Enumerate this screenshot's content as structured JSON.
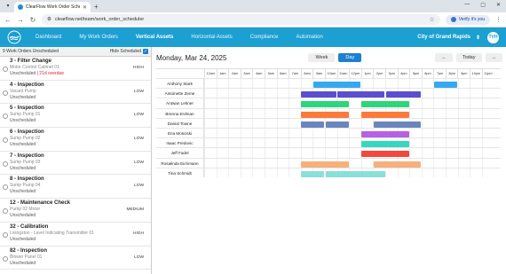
{
  "browser": {
    "tab_title": "ClearFlow Work Order Schedul...",
    "url": "clearflow.net/team/work_order_scheduler",
    "verify_label": "Verify it's you"
  },
  "appnav": {
    "links": [
      "Dashboard",
      "My Work Orders",
      "Vertical Assets",
      "Horizontal Assets",
      "Compliance",
      "Automation"
    ],
    "active_index": 2,
    "city": "City of Grand Rapids",
    "avatar": "TVH"
  },
  "sidebar": {
    "count_label": "9 Work Orders Unscheduled",
    "hide_label": "Hide Scheduled",
    "items": [
      {
        "title": "3 - Filter Change",
        "sub": "Motor Control Cabinet 01",
        "status": "Unscheduled",
        "overdue": "21d overdue",
        "priority": "HIGH"
      },
      {
        "title": "4 - Inspection",
        "sub": "Vacant Pump",
        "status": "Unscheduled",
        "overdue": "",
        "priority": "LOW"
      },
      {
        "title": "5 - Inspection",
        "sub": "Sump Pump 01",
        "status": "Unscheduled",
        "overdue": "",
        "priority": "LOW"
      },
      {
        "title": "6 - Inspection",
        "sub": "Sump Pump 02",
        "status": "Unscheduled",
        "overdue": "",
        "priority": "LOW"
      },
      {
        "title": "7 - Inspection",
        "sub": "Sump Pump 03",
        "status": "Unscheduled",
        "overdue": "",
        "priority": "LOW"
      },
      {
        "title": "8 - Inspection",
        "sub": "Sump Pump 04",
        "status": "Unscheduled",
        "overdue": "",
        "priority": "LOW"
      },
      {
        "title": "12 - Maintenance Check",
        "sub": "Pump 02 Motor",
        "status": "Unscheduled",
        "overdue": "",
        "priority": "MEDIUM"
      },
      {
        "title": "32 - Calibration",
        "sub": "Livingston - Level Indicating Transmitter 01",
        "status": "Unscheduled",
        "overdue": "",
        "priority": "HIGH"
      },
      {
        "title": "82 - Inspection",
        "sub": "Blower Panel 01",
        "status": "Unscheduled",
        "overdue": "",
        "priority": "LOW"
      }
    ]
  },
  "calendar": {
    "date": "Monday, Mar 24, 2025",
    "views": [
      "Week",
      "Day"
    ],
    "active_view": "Day",
    "prev": "←",
    "today": "Today",
    "next": "→",
    "hours": [
      "12am",
      "1am",
      "2am",
      "3am",
      "4am",
      "5am",
      "6am",
      "7am",
      "8am",
      "9am",
      "10am",
      "11am",
      "12pm",
      "1pm",
      "2pm",
      "3pm",
      "4pm",
      "5pm",
      "6pm",
      "7pm",
      "8pm",
      "9pm",
      "10pm",
      "11pm"
    ],
    "technicians": [
      {
        "name": "Anthony Stark",
        "color": "#35a9f0",
        "blocks": [
          [
            9,
            13
          ],
          [
            19,
            21
          ]
        ]
      },
      {
        "name": "Antoinette Zeme",
        "color": "#5a4fcf",
        "blocks": [
          [
            8,
            11
          ],
          [
            11,
            15
          ],
          [
            15,
            18
          ]
        ]
      },
      {
        "name": "Antwan Lehner",
        "color": "#2ed57a",
        "blocks": [
          [
            8,
            12
          ],
          [
            13,
            17
          ]
        ]
      },
      {
        "name": "Brenna Erdman",
        "color": "#fb7a3b",
        "blocks": [
          [
            8,
            12
          ],
          [
            13,
            17
          ]
        ]
      },
      {
        "name": "Danial Towne",
        "color": "#6a86be",
        "blocks": [
          [
            8,
            10
          ],
          [
            10,
            12
          ],
          [
            14,
            18
          ]
        ]
      },
      {
        "name": "Ena Mosciski",
        "color": "#b760e3",
        "blocks": [
          [
            13,
            17
          ]
        ]
      },
      {
        "name": "Isaac Predovic",
        "color": "#35d7c0",
        "blocks": [
          [
            13,
            17
          ]
        ]
      },
      {
        "name": "Jeff Fadel",
        "color": "#f2483f",
        "blocks": [
          [
            13,
            17
          ]
        ]
      },
      {
        "name": "Rosalinda Eichmann",
        "color": "#f7b07c",
        "blocks": [
          [
            8,
            12
          ],
          [
            14,
            18
          ]
        ]
      },
      {
        "name": "Tina Schmidt",
        "color": "#8ae0d9",
        "blocks": [
          [
            8,
            10
          ],
          [
            10,
            15
          ]
        ]
      }
    ]
  }
}
